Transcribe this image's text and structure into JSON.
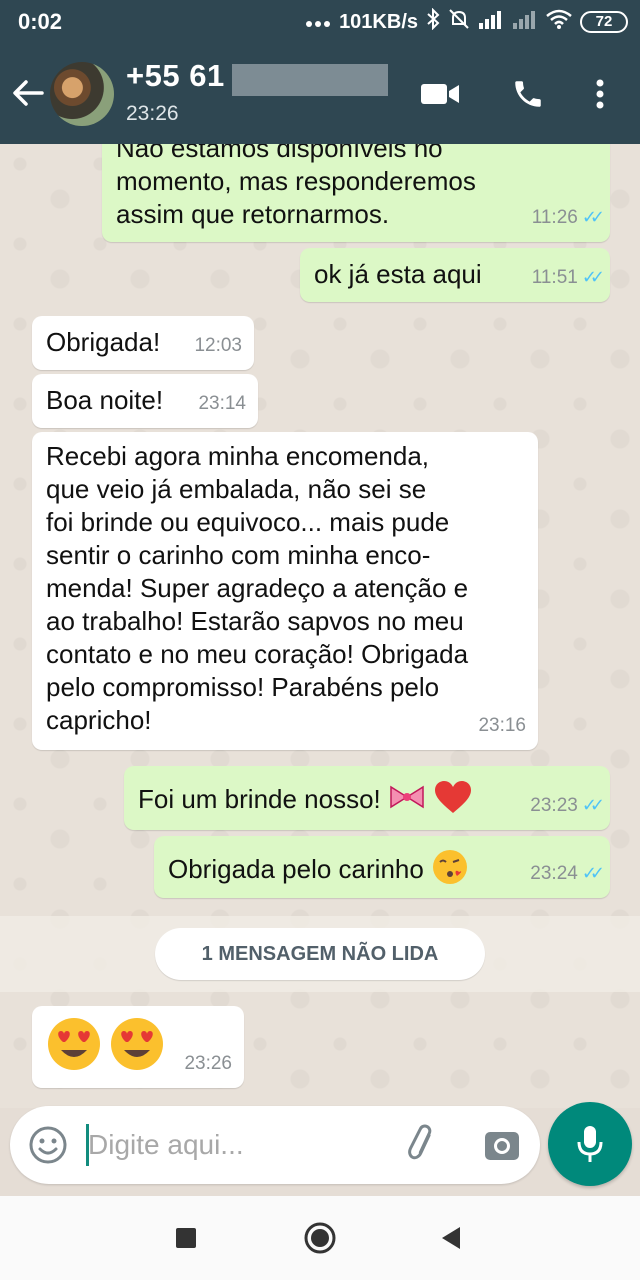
{
  "status_bar": {
    "time": "0:02",
    "speed": "101KB/s",
    "battery": "72",
    "icons": [
      "dots-icon",
      "bluetooth-icon",
      "mute-icon",
      "signal-icon",
      "signal-weak-icon",
      "wifi-icon",
      "battery-icon"
    ]
  },
  "header": {
    "contact_name": "+55 61",
    "status": "23:26",
    "colors": {
      "bar": "#2f4752"
    }
  },
  "messages": [
    {
      "direction": "out",
      "text_lines": [
        "Não estamos disponíveis no",
        "momento, mas responderemos",
        "assim que retornarmos."
      ],
      "time": "11:26",
      "ticks": "read"
    },
    {
      "direction": "out",
      "text_lines": [
        "ok já esta aqui"
      ],
      "time": "11:51",
      "ticks": "read"
    },
    {
      "direction": "in",
      "text_lines": [
        "Obrigada!"
      ],
      "time": "12:03"
    },
    {
      "direction": "in",
      "text_lines": [
        "Boa noite!"
      ],
      "time": "23:14"
    },
    {
      "direction": "in",
      "text_lines": [
        "Recebi agora minha encomenda,",
        "que veio já embalada, não sei se",
        "foi brinde ou equivoco... mais pude",
        "sentir o carinho com minha enco-",
        "menda! Super agradeço a atenção e",
        "ao trabalho! Estarão sapvos no meu",
        "contato e no meu coração! Obrigada",
        "pelo compromisso! Parabéns pelo",
        "capricho!"
      ],
      "time": "23:16"
    },
    {
      "direction": "out",
      "text": "Foi um brinde nosso!",
      "emojis": [
        "ribbon-emoji",
        "red-heart-emoji"
      ],
      "time": "23:23",
      "ticks": "read"
    },
    {
      "direction": "out",
      "text": "Obrigada pelo carinho",
      "emojis": [
        "face-blowing-kiss-emoji"
      ],
      "time": "23:24",
      "ticks": "read"
    },
    {
      "direction": "in",
      "emojis": [
        "heart-eyes-emoji",
        "heart-eyes-emoji"
      ],
      "time": "23:26"
    }
  ],
  "unread_banner": "1 MENSAGEM NÃO LIDA",
  "input": {
    "placeholder": "Digite aqui...",
    "value": ""
  },
  "colors": {
    "outgoing_bubble": "#dcf8c6",
    "incoming_bubble": "#ffffff",
    "read_ticks": "#4fc3f7",
    "mic_button": "#00897b"
  }
}
